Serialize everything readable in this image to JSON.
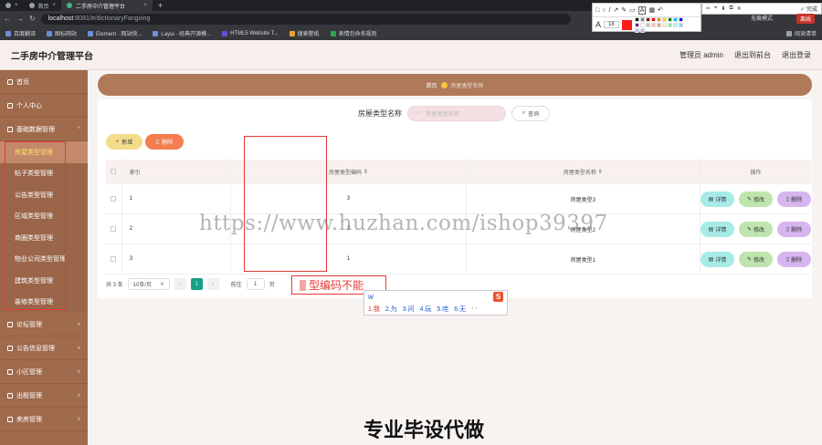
{
  "browser": {
    "tabs": [
      {
        "label": ""
      },
      {
        "label": "首页"
      },
      {
        "label": "二手房中介管理平台"
      }
    ],
    "url_host": "localhost",
    "url_rest": ":8081/#/dictionaryFangxing",
    "bookmarks": [
      "百度翻译",
      "图标网站",
      "Element - 网站快...",
      "Layui - 经典开源模...",
      "HTML5 Website T...",
      "搜索壁纸",
      "表情包命名规则"
    ],
    "bookmarks_right": "阅读清单"
  },
  "annotation_toolbar": {
    "font_size": "18",
    "finish_label": "完成",
    "mode_label": "离线",
    "nomark_label": "无痕模式",
    "colors": [
      "#000000",
      "#7f7f7f",
      "#8b0000",
      "#ff0000",
      "#ff8c00",
      "#ffd700",
      "#008000",
      "#00bfff",
      "#0000ff",
      "#800080",
      "#ffffff",
      "#c0c0c0",
      "#ffc0cb",
      "#ffa07a",
      "#fff59d",
      "#90ee90",
      "#afeeee",
      "#87cefa",
      "#b0c4de",
      "#dda0dd"
    ]
  },
  "app": {
    "title": "二手房中介管理平台",
    "admin_label": "管理员 admin",
    "exit_front": "退出到前台",
    "logout": "退出登录"
  },
  "sidebar": {
    "items_top": [
      {
        "label": "首页"
      },
      {
        "label": "个人中心"
      },
      {
        "label": "基础数据管理"
      }
    ],
    "sub_items": [
      {
        "label": "房屋类型管理"
      },
      {
        "label": "帖子类型管理"
      },
      {
        "label": "公告类型管理"
      },
      {
        "label": "区域类型管理"
      },
      {
        "label": "商圈类型管理"
      },
      {
        "label": "物业公司类型管理"
      },
      {
        "label": "建筑类型管理"
      },
      {
        "label": "装修类型管理"
      }
    ],
    "items_bottom": [
      {
        "label": "论坛管理"
      },
      {
        "label": "公告信息管理"
      },
      {
        "label": "小区管理"
      },
      {
        "label": "出租管理"
      },
      {
        "label": "卖房管理"
      }
    ]
  },
  "breadcrumb": {
    "home": "首页",
    "current": "房屋类型名称"
  },
  "search": {
    "label": "房屋类型名称",
    "placeholder": "房屋类型名称",
    "button": "查询"
  },
  "actions": {
    "add": "新增",
    "delete": "删除"
  },
  "table": {
    "headers": {
      "index": "索引",
      "code": "房屋类型编码",
      "name": "房屋类型名称",
      "ops": "操作"
    },
    "rows": [
      {
        "index": "1",
        "code": "3",
        "name": "房屋类型3"
      },
      {
        "index": "2",
        "code": "2",
        "name": "房屋类型2"
      },
      {
        "index": "3",
        "code": "1",
        "name": "房屋类型1"
      }
    ],
    "ops": {
      "detail": "详情",
      "edit": "修改",
      "remove": "删除"
    }
  },
  "pager": {
    "total": "共 3 条",
    "size": "10条/页",
    "page": "1",
    "goto": "前往",
    "goto_value": "1",
    "page_suffix": "页"
  },
  "overlay": {
    "tip": "型编码不能",
    "ime_input": "w",
    "ime_candidates": [
      "1.我",
      "2.为",
      "3.问",
      "4.玩",
      "5.哇",
      "6.无"
    ],
    "watermark": "https://www.huzhan.com/ishop39397",
    "big_text": "专业毕设代做"
  }
}
